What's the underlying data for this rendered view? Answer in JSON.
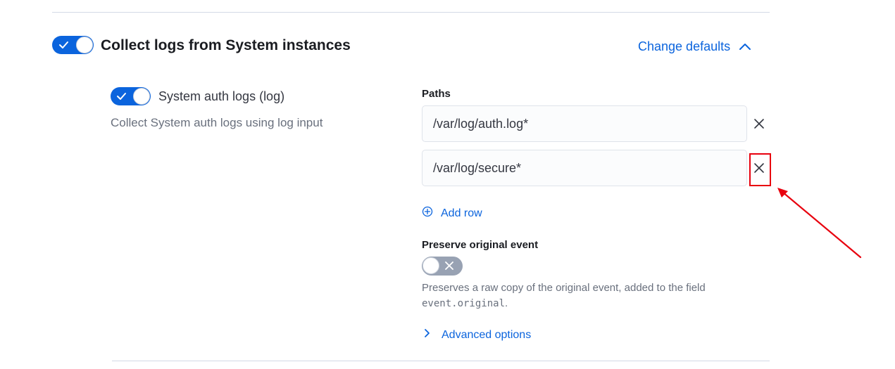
{
  "section": {
    "title": "Collect logs from System instances",
    "enabled": true,
    "change_defaults_label": "Change defaults"
  },
  "input": {
    "title": "System auth logs (log)",
    "description": "Collect System auth logs using log input",
    "enabled": true
  },
  "paths": {
    "label": "Paths",
    "rows": [
      {
        "value": "/var/log/auth.log*"
      },
      {
        "value": "/var/log/secure*"
      }
    ],
    "add_row_label": "Add row"
  },
  "preserve": {
    "label": "Preserve original event",
    "enabled": false,
    "help_prefix": "Preserves a raw copy of the original event, added to the field",
    "help_code": "event.original",
    "help_suffix": "."
  },
  "advanced": {
    "label": "Advanced options"
  },
  "colors": {
    "accent": "#0b64dd",
    "annotation": "#e8000e",
    "switch_off": "#98a2b3"
  },
  "icons": {
    "toggle_on": "check-icon",
    "toggle_off": "cross-icon",
    "remove": "close-icon",
    "add": "plus-circle-icon",
    "collapse": "chevron-up-icon",
    "expand": "chevron-right-icon"
  }
}
